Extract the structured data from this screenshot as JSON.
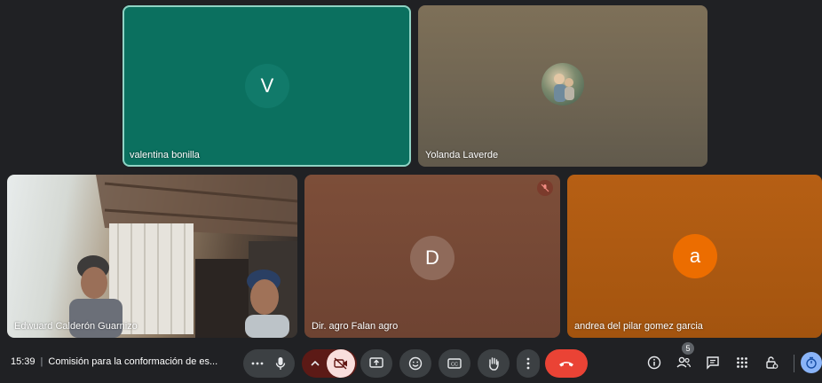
{
  "participants": [
    {
      "name": "valentina bonilla",
      "initial": "V"
    },
    {
      "name": "Yolanda Laverde"
    },
    {
      "name": "Edwuard Calderón Guarnizo"
    },
    {
      "name": "Dir. agro Falan agro",
      "initial": "D"
    },
    {
      "name": "andrea del pilar gomez garcia",
      "initial": "a"
    }
  ],
  "bar": {
    "time": "15:39",
    "meeting_title": "Comisión para la conformación de es...",
    "people_count": "5"
  },
  "colors": {
    "background": "#202124",
    "end_call": "#ea4335",
    "camera_off_bg": "#f9dedc",
    "active_border": "#8fd3c4"
  },
  "icons": [
    "more-icon",
    "mic-icon",
    "chevron-up-icon",
    "camera-off-icon",
    "present-icon",
    "emoji-icon",
    "captions-icon",
    "raise-hand-icon",
    "more-vert-icon",
    "end-call-icon",
    "info-icon",
    "people-icon",
    "chat-icon",
    "activities-icon",
    "host-controls-icon",
    "timer-icon",
    "mic-off-icon"
  ]
}
